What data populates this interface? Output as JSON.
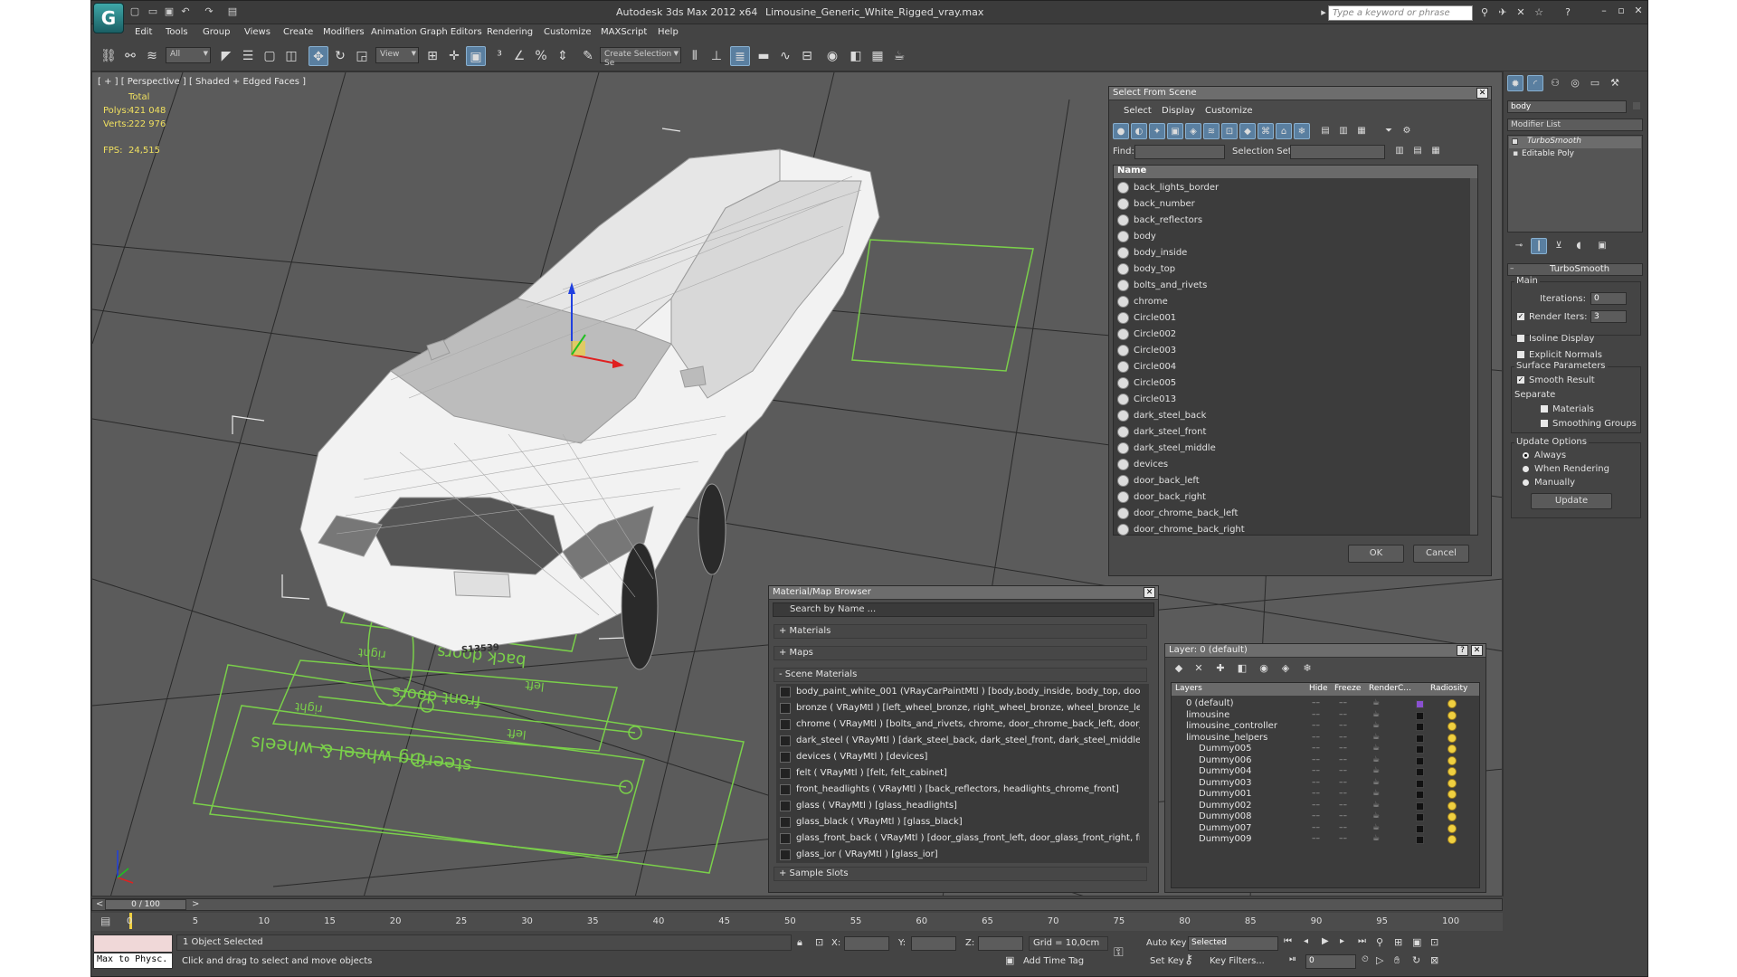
{
  "title": {
    "app": "Autodesk 3ds Max  2012 x64",
    "file": "Limousine_Generic_White_Rigged_vray.max"
  },
  "search_placeholder": "Type a keyword or phrase",
  "menu": [
    "Edit",
    "Tools",
    "Group",
    "Views",
    "Create",
    "Modifiers",
    "Animation",
    "Graph Editors",
    "Rendering",
    "Customize",
    "MAXScript",
    "Help"
  ],
  "toolbar": {
    "filter": "All",
    "refcoord": "View",
    "selection_set": "Create Selection Se"
  },
  "viewport": {
    "label": "[ + ] [ Perspective ] [ Shaded + Edged Faces ]",
    "stats": {
      "total_label": "Total",
      "polys_label": "Polys:",
      "polys": "421 048",
      "verts_label": "Verts:",
      "verts": "222 976",
      "fps_label": "FPS:",
      "fps": "24,515"
    },
    "plate": "S13539",
    "ground_text": {
      "back_doors": "back doors",
      "front_doors": "front doors",
      "steering": "steering wheel & wheels",
      "left1": "left",
      "right1": "right",
      "left2": "left",
      "right2": "right"
    }
  },
  "select_from_scene": {
    "title": "Select From Scene",
    "menu": [
      "Select",
      "Display",
      "Customize"
    ],
    "find_label": "Find:",
    "selset_label": "Selection Set:",
    "col_name": "Name",
    "items": [
      "back_lights_border",
      "back_number",
      "back_reflectors",
      "body",
      "body_inside",
      "body_top",
      "bolts_and_rivets",
      "chrome",
      "Circle001",
      "Circle002",
      "Circle003",
      "Circle004",
      "Circle005",
      "Circle013",
      "dark_steel_back",
      "dark_steel_front",
      "dark_steel_middle",
      "devices",
      "door_back_left",
      "door_back_right",
      "door_chrome_back_left",
      "door_chrome_back_right"
    ],
    "ok": "OK",
    "cancel": "Cancel"
  },
  "material_browser": {
    "title": "Material/Map Browser",
    "search": "Search by Name ...",
    "cat_materials": "+ Materials",
    "cat_maps": "+ Maps",
    "cat_scene": "- Scene Materials",
    "cat_sample": "+ Sample Slots",
    "items": [
      "body_paint_white_001 (VRayCarPaintMtl ) [body,body_inside, body_top, door...",
      "bronze  ( VRayMtl ) [left_wheel_bronze, right_wheel_bronze, wheel_bronze_left,...",
      "chrome  ( VRayMtl ) [bolts_and_rivets, chrome, door_chrome_back_left, door_c...",
      "dark_steel  ( VRayMtl ) [dark_steel_back, dark_steel_front, dark_steel_middle, fr...",
      "devices  ( VRayMtl ) [devices]",
      "felt  ( VRayMtl ) [felt, felt_cabinet]",
      "front_headlights  ( VRayMtl ) [back_reflectors, headlights_chrome_front]",
      "glass  ( VRayMtl ) [glass_headlights]",
      "glass_black  ( VRayMtl ) [glass_black]",
      "glass_front_back  ( VRayMtl ) [door_glass_front_left, door_glass_front_right, fro...",
      "glass_ior  ( VRayMtl ) [glass_ior]"
    ]
  },
  "layers": {
    "title": "Layer: 0 (default)",
    "help": "?",
    "cols": [
      "Layers",
      "Hide",
      "Freeze",
      "Render",
      "C...",
      "Radiosity"
    ],
    "rows": [
      "0 (default)",
      "limousine",
      "limousine_controller",
      "limousine_helpers",
      "Dummy005",
      "Dummy006",
      "Dummy004",
      "Dummy003",
      "Dummy001",
      "Dummy002",
      "Dummy008",
      "Dummy007",
      "Dummy009"
    ]
  },
  "command_panel": {
    "object_name": "body",
    "modifier_list": "Modifier List",
    "stack": [
      "TurboSmooth",
      "Editable Poly"
    ],
    "rollout": "TurboSmooth",
    "main": "Main",
    "iterations_label": "Iterations:",
    "iterations": "0",
    "render_iters_label": "Render Iters:",
    "render_iters": "3",
    "isoline": "Isoline Display",
    "explicit": "Explicit Normals",
    "surface": "Surface Parameters",
    "smooth_result": "Smooth Result",
    "separate": "Separate",
    "materials": "Materials",
    "smoothing_groups": "Smoothing Groups",
    "update_options": "Update Options",
    "always": "Always",
    "when_rendering": "When Rendering",
    "manually": "Manually",
    "update": "Update"
  },
  "timeline": {
    "frame": "0 / 100",
    "ticks": [
      "0",
      "5",
      "10",
      "15",
      "20",
      "25",
      "30",
      "35",
      "40",
      "45",
      "50",
      "55",
      "60",
      "65",
      "70",
      "75",
      "80",
      "85",
      "90",
      "95",
      "100"
    ]
  },
  "status": {
    "maxscript": "Max to Physc.",
    "selected": "1 Object Selected",
    "prompt": "Click and drag to select and move objects",
    "x_label": "X:",
    "y_label": "Y:",
    "z_label": "Z:",
    "grid": "Grid = 10,0cm",
    "add_time_tag": "Add Time Tag",
    "auto_key": "Auto Key",
    "set_key": "Set Key",
    "selected_dd": "Selected",
    "key_filters": "Key Filters...",
    "frame_field": "0"
  },
  "colors": {
    "accent": "#5a7fa0",
    "viewport_bg": "#5b5b5b",
    "grid_green": "#7ad04a",
    "stats_yellow": "#f0e060"
  }
}
